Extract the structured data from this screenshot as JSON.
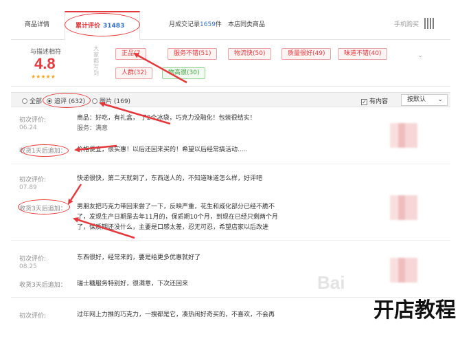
{
  "tabs": [
    {
      "label": "商品详情"
    },
    {
      "label": "累计评价",
      "count": "31483"
    },
    {
      "label": "月成交记录",
      "count": "1659",
      "suffix": "件"
    },
    {
      "label": "本店同类商品"
    }
  ],
  "mobile_label": "手机购买",
  "rating": {
    "label": "与描述相符",
    "score": "4.8",
    "stars": "★★★★★",
    "side_label": "大家都写到",
    "tags": [
      {
        "text": "正品(7",
        "color": "red"
      },
      {
        "text": "服务不错(51)",
        "color": "red"
      },
      {
        "text": "物流快(50)",
        "color": "red"
      },
      {
        "text": "质量很好(49)",
        "color": "red"
      },
      {
        "text": "味道不错(40)",
        "color": "red"
      },
      {
        "text": "人群(32)",
        "color": "red"
      },
      {
        "text": "物高很(30)",
        "color": "green"
      }
    ],
    "collapse_icon": "chevron-down-icon"
  },
  "filter": {
    "options": [
      {
        "label": "全部",
        "selected": false
      },
      {
        "label": "追评 (632)",
        "selected": true
      },
      {
        "label": "图片 (169)",
        "selected": false
      }
    ],
    "has_content_label": "有内容",
    "sort_label": "按默认",
    "sort_chevron": "⌄"
  },
  "comments": [
    {
      "first_label": "初次评价:",
      "first_date": "06.24",
      "first_text": "商品：好吃，有礼盒，  了2个冰袋，巧克力没融化！包装很结实！",
      "first_text2": "服务：满意",
      "append_label": "收货1天后追加：",
      "append_text": "价格便宜，很实惠！以后还回来买的！希望以后经常搞活动....."
    },
    {
      "first_label": "初次评价:",
      "first_date": "07.89",
      "first_text": "快递很快，第二天就到了，东西送人的，不知道味道怎么样，好评吧",
      "append_label": "收货3天后追加：",
      "append_text": "男朋友把巧克力带回来尝了一下，反映严重，花生和威化部分已经不脆不",
      "append_text2": "了，发现生产日期是去年11月的，保质期10个月，到现在已经只剩两个月",
      "append_text3": "了，保质期还没什么，主要是口感太差，忍无可忍，希望店家以后改进"
    },
    {
      "first_label": "初次评价:",
      "first_date": "08.25",
      "first_text": "东西很好，经常来的，要是给更多优惠就好了",
      "append_label": "收货3天后追加：",
      "append_text": "瑞士糖服务特别好，很满意，下次还回来"
    },
    {
      "first_label": "初次评价:",
      "first_text": "过年网上力推的巧克力，一搜都是它，凑热闹好奇买的，不喜欢，不会再"
    }
  ],
  "watermark": "Bai",
  "brand": "开店教程",
  "colors": {
    "accent": "#e4393c",
    "link": "#336fc5",
    "tag_green": "#3f9d3f",
    "star": "#f5a623"
  }
}
